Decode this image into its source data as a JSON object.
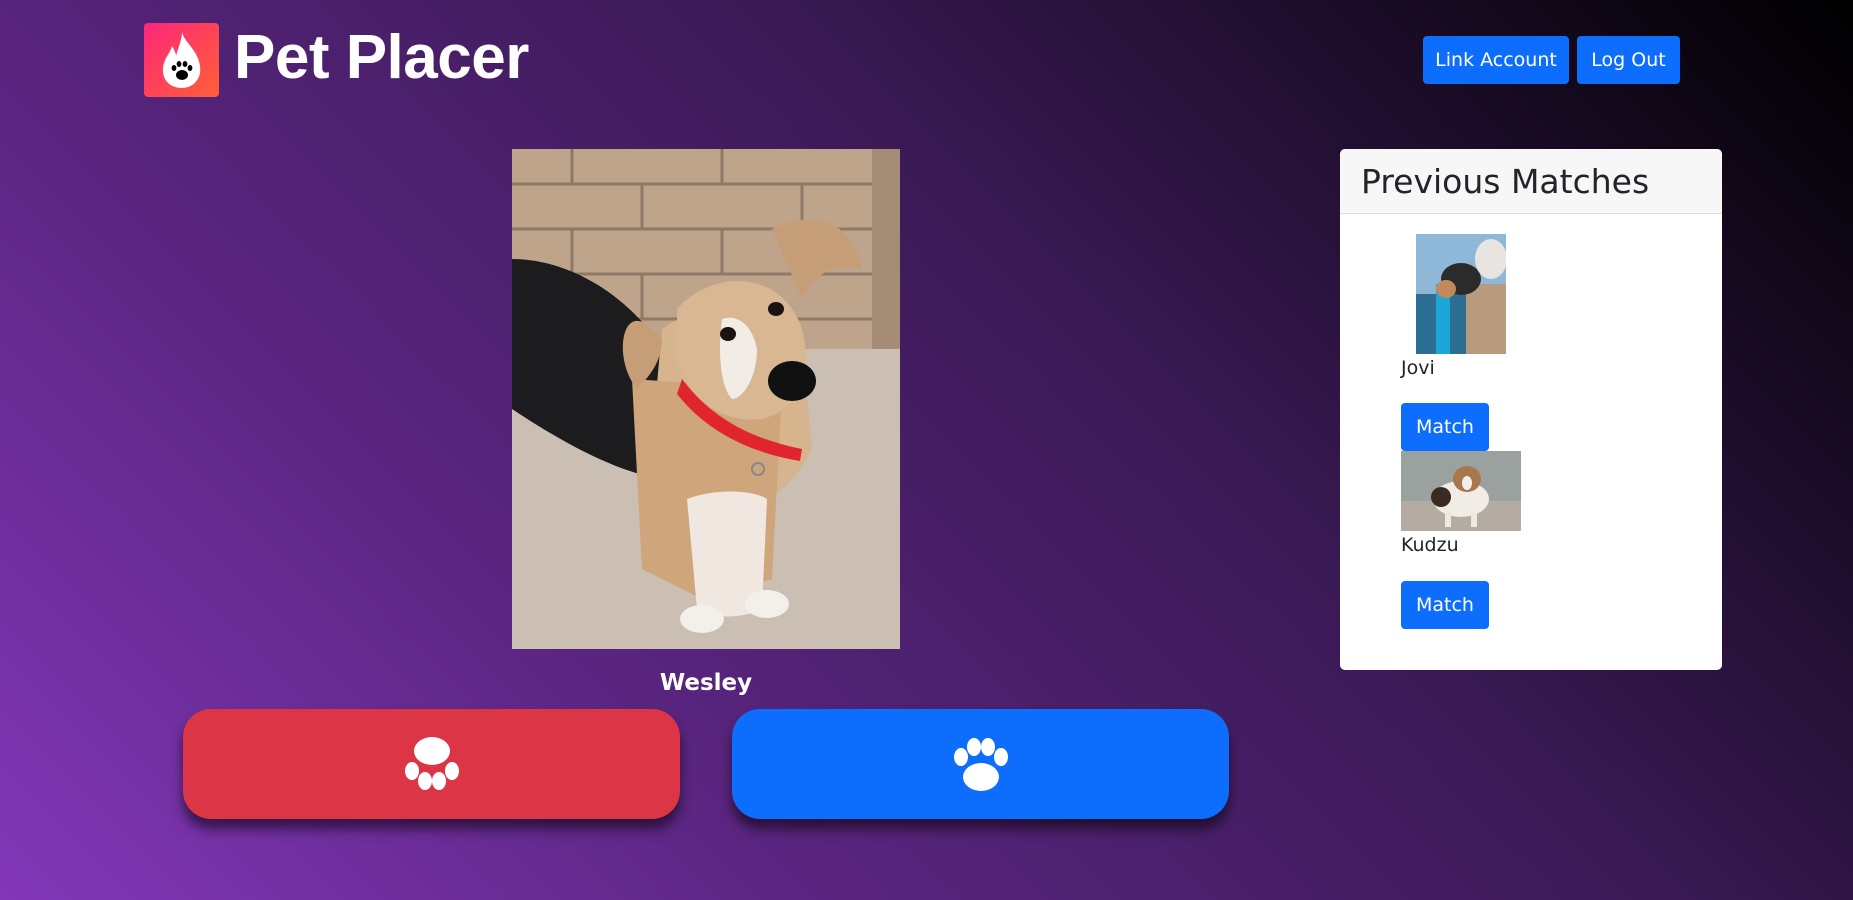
{
  "header": {
    "brand": "Pet Placer",
    "logo_icon": "flame-paw-icon",
    "link_account_label": "Link Account",
    "logout_label": "Log Out"
  },
  "current_pet": {
    "name": "Wesley",
    "photo": "dog-photo"
  },
  "swipe": {
    "reject_icon": "paw-down-icon",
    "like_icon": "paw-up-icon",
    "reject_color": "#dc3545",
    "like_color": "#0d6efd"
  },
  "matches": {
    "title": "Previous Matches",
    "items": [
      {
        "name": "Jovi",
        "button_label": "Match"
      },
      {
        "name": "Kudzu",
        "button_label": "Match"
      }
    ]
  },
  "colors": {
    "primary": "#0d6efd",
    "danger": "#dc3545",
    "brand_gradient_start": "#fd267a",
    "brand_gradient_end": "#ff6036"
  }
}
